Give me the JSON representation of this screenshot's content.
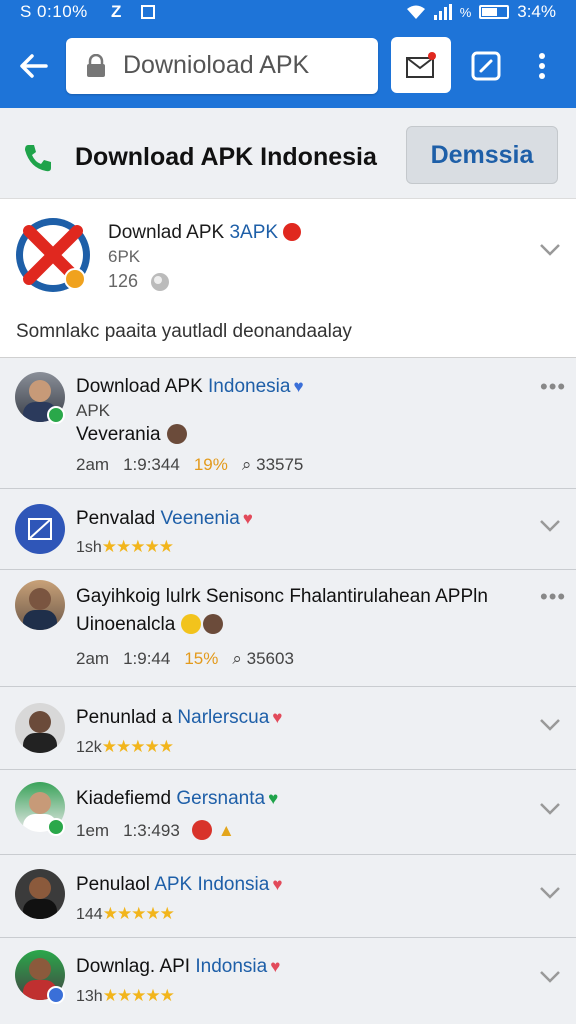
{
  "status_bar": {
    "left_text": "S 0:10%",
    "carrier_icons": "Z",
    "battery_pct": "%",
    "time": "3:4%"
  },
  "toolbar": {
    "url": "Downioload APK"
  },
  "header": {
    "title": "Download APK Indonesia",
    "button_label": "Demssia"
  },
  "app_card": {
    "name": "Downlad APK ",
    "name_highlight": "3APK",
    "type": "6PK",
    "count": "126",
    "description": "Somnlakc paaita yautladl deonandaalay"
  },
  "items": [
    {
      "line1": "Download APK ",
      "line1_highlight": "Indonesia",
      "line2": "APK",
      "line3": "Veverania",
      "meta_time": "2am",
      "meta_clock": "1:9:344",
      "meta_pct": "19%",
      "meta_count": "33575"
    },
    {
      "line1": "Penvalad ",
      "line1_highlight": "Veenenia",
      "rating_prefix": "1sh",
      "stars": "★★★★★"
    },
    {
      "line1": "Gayihkoig lulrk Senisonc Fhalantirulahean APPln",
      "line2": "Uinoenalcla",
      "meta_time": "2am",
      "meta_clock": "1:9:44",
      "meta_pct": "15%",
      "meta_count": "35603"
    },
    {
      "line1": "Penunlad a ",
      "line1_highlight": "Narlerscua",
      "rating_prefix": "12k",
      "stars": "★★★★★"
    },
    {
      "line1": "Kiadefiemd ",
      "line1_highlight": "Gersnanta",
      "meta_time": "1em",
      "meta_clock": "1:3:493"
    },
    {
      "line1": "Penulaol ",
      "line1_highlight": "APK Indonsia",
      "rating_prefix": "144",
      "stars": "★★★★★"
    },
    {
      "line1": "Downlag. API ",
      "line1_highlight": "Indonsia",
      "rating_prefix": "13h",
      "stars": "★★★★★"
    }
  ],
  "icons": [
    "back-arrow-icon",
    "lock-icon",
    "mail-icon",
    "edit-icon",
    "more-vert-icon",
    "phone-icon",
    "globe-icon",
    "chevron-down-icon",
    "more-horiz-icon",
    "heart-icon"
  ],
  "colors": {
    "appbar": "#1e74d8",
    "accent_blue": "#1e5fa8",
    "stars": "#f2b51c",
    "percent": "#e39a1c"
  }
}
